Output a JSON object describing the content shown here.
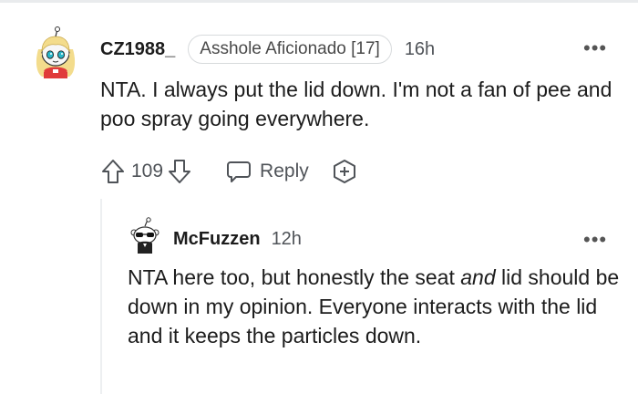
{
  "comment": {
    "username": "CZ1988_",
    "flair": "Asshole Aficionado [17]",
    "time": "16h",
    "body": "NTA. I always put the lid down. I'm not a fan of pee and poo spray going everywhere.",
    "votes": "109",
    "reply_label": "Reply",
    "more_label": "•••"
  },
  "reply": {
    "username": "McFuzzen",
    "time": "12h",
    "body_before": "NTA here too, but honestly the seat ",
    "body_emph": "and",
    "body_after": " lid should be down in my opinion. Everyone interacts with the lid and it keeps the particles down.",
    "more_label": "•••"
  },
  "colors": {
    "text": "#1c1c1c",
    "meta": "#4f5358",
    "border": "#d7dadc"
  }
}
